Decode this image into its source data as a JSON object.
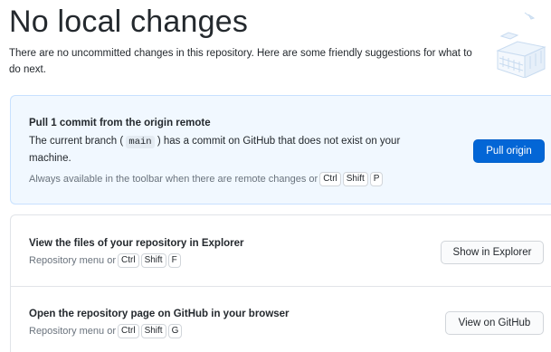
{
  "header": {
    "title": "No local changes",
    "subtitle": "There are no uncommitted changes in this repository. Here are some friendly suggestions for what to do next."
  },
  "pull": {
    "title": "Pull 1 commit from the origin remote",
    "desc_before": "The current branch (",
    "branch": "main",
    "desc_after": ") has a commit on GitHub that does not exist on your machine.",
    "hint": "Always available in the toolbar when there are remote changes or",
    "keys": [
      "Ctrl",
      "Shift",
      "P"
    ],
    "button": "Pull origin"
  },
  "explorer": {
    "title": "View the files of your repository in Explorer",
    "hint": "Repository menu or",
    "keys": [
      "Ctrl",
      "Shift",
      "F"
    ],
    "button": "Show in Explorer"
  },
  "github": {
    "title": "Open the repository page on GitHub in your browser",
    "hint": "Repository menu or",
    "keys": [
      "Ctrl",
      "Shift",
      "G"
    ],
    "button": "View on GitHub"
  },
  "colors": {
    "accent": "#0366d6",
    "primary_card_bg": "#f1f8ff",
    "border": "#e1e4e8"
  },
  "icons": {
    "illustration": "blank-slate-illustration-icon"
  }
}
